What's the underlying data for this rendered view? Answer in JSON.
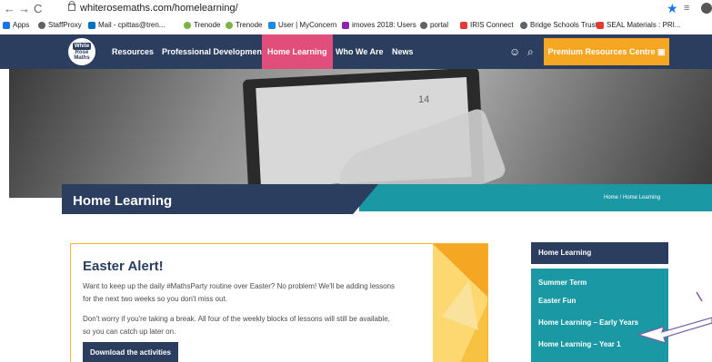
{
  "browser": {
    "url": "whiterosemaths.com/homelearning/",
    "bookmarks": [
      {
        "label": "Apps",
        "color": "#1a73e8"
      },
      {
        "label": "StaffProxy",
        "color": "#5f6368"
      },
      {
        "label": "Mail - cpittas@tren...",
        "color": "#0072c6"
      },
      {
        "label": "Trenode",
        "color": "#7cb342"
      },
      {
        "label": "Trenode",
        "color": "#7cb342"
      },
      {
        "label": "User | MyConcern",
        "color": "#1e88e5"
      },
      {
        "label": "imoves 2018: Users",
        "color": "#8e24aa"
      },
      {
        "label": "portal",
        "color": "#5f6368"
      },
      {
        "label": "IRIS Connect",
        "color": "#e53935"
      },
      {
        "label": "Bridge Schools Trust",
        "color": "#5f6368"
      },
      {
        "label": "SEAL Materials : PRI...",
        "color": "#e53935"
      }
    ]
  },
  "site": {
    "logo": {
      "line1": "White",
      "line2": "Rose",
      "line3": "Maths"
    },
    "nav": [
      "Resources",
      "Professional Development",
      "Home Learning",
      "Who We Are",
      "News"
    ],
    "active_nav": "Home Learning",
    "premium_label": "Premium Resources Centre",
    "colors": {
      "navy": "#2b3e5f",
      "teal": "#1a98a4",
      "pink": "#e24e7c",
      "orange": "#f5a623"
    }
  },
  "hero": {
    "screen_number": "14"
  },
  "page": {
    "title": "Home Learning",
    "breadcrumb": "Home / Home Learning"
  },
  "alert": {
    "heading": "Easter Alert!",
    "para1_line1": "Want to keep up the daily #MathsParty routine over Easter? No problem! We'll be adding lessons",
    "para1_line2": "for the next two weeks so you don't miss out.",
    "para2_line1": "Don't worry if you're taking a break. All four of the weekly blocks of lessons will still be available,",
    "para2_line2": "so you can catch up later on.",
    "button": "Download the activities"
  },
  "sidebar": {
    "heading": "Home Learning",
    "items": [
      "Summer Term",
      "Easter Fun",
      "Home Learning – Early Years",
      "Home Learning – Year 1"
    ]
  }
}
